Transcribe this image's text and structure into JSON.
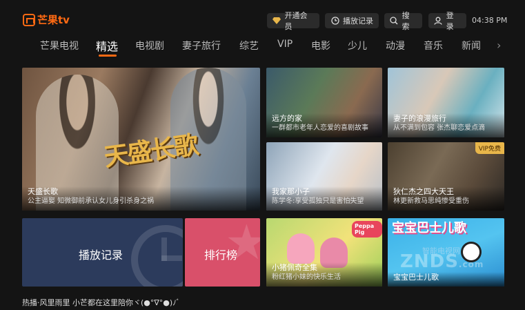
{
  "logo": {
    "text": "芒果tv"
  },
  "header": {
    "vip_label": "开通会员",
    "history_label": "播放记录",
    "search_label": "搜索",
    "login_label": "登录",
    "time": "04:38 PM"
  },
  "tabs": [
    "芒果电视",
    "精选",
    "电视剧",
    "妻子旅行",
    "综艺",
    "VIP",
    "电影",
    "少儿",
    "动漫",
    "音乐",
    "新闻"
  ],
  "active_tab": "精选",
  "hero": {
    "title": "天盛长歌",
    "subtitle": "公主逼娶 知微御前承认女儿身引杀身之祸",
    "art_text": "天盛长歌"
  },
  "cards": [
    {
      "title": "远方的家",
      "subtitle": "一群都市老年人恋爱的喜剧故事"
    },
    {
      "title": "妻子的浪漫旅行",
      "subtitle": "从不满到包容 张杰聊恋爱点滴"
    },
    {
      "title": "我家那小子",
      "subtitle": "陈学冬:享受孤独只是害怕失望"
    },
    {
      "title": "狄仁杰之四大天王",
      "subtitle": "林更新救马思纯惨受重伤",
      "badge": "VIP免费"
    },
    {
      "title": "小猪佩奇全集",
      "subtitle": "粉红猪小妹的快乐生活",
      "logo": "Peppa Pig"
    },
    {
      "title": "宝宝巴士儿歌",
      "art_text": "宝宝巴士儿歌"
    }
  ],
  "shortcuts": {
    "history": "播放记录",
    "ranking": "排行榜"
  },
  "watermark": {
    "main": "ZNDS",
    "suffix": ".com",
    "top": "智能电视网"
  },
  "ticker": "热播·风里雨里 小芒都在这里陪你ヾ(●°∇°●)ﾉﾞ",
  "colors": {
    "accent": "#ff6a13",
    "history_tile": "#2c3b5c",
    "ranking_tile": "#d9506a",
    "vip_gold": "#e8b64a"
  }
}
